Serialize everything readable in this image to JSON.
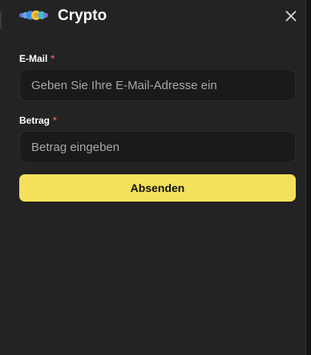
{
  "header": {
    "title": "Crypto",
    "logo_icon": "crypto-coins-logo",
    "close_icon": "close-icon"
  },
  "form": {
    "email": {
      "label": "E-Mail",
      "required_mark": "*",
      "value": "",
      "placeholder": "Geben Sie Ihre E-Mail-Adresse ein"
    },
    "amount": {
      "label": "Betrag",
      "required_mark": "*",
      "value": "",
      "placeholder": "Betrag eingeben"
    },
    "submit_label": "Absenden"
  },
  "colors": {
    "panel_background": "#232323",
    "input_background": "#1a1a1a",
    "accent": "#f3e05b",
    "required_mark": "#e25757",
    "text": "#ffffff",
    "placeholder": "#a7a7a7"
  }
}
